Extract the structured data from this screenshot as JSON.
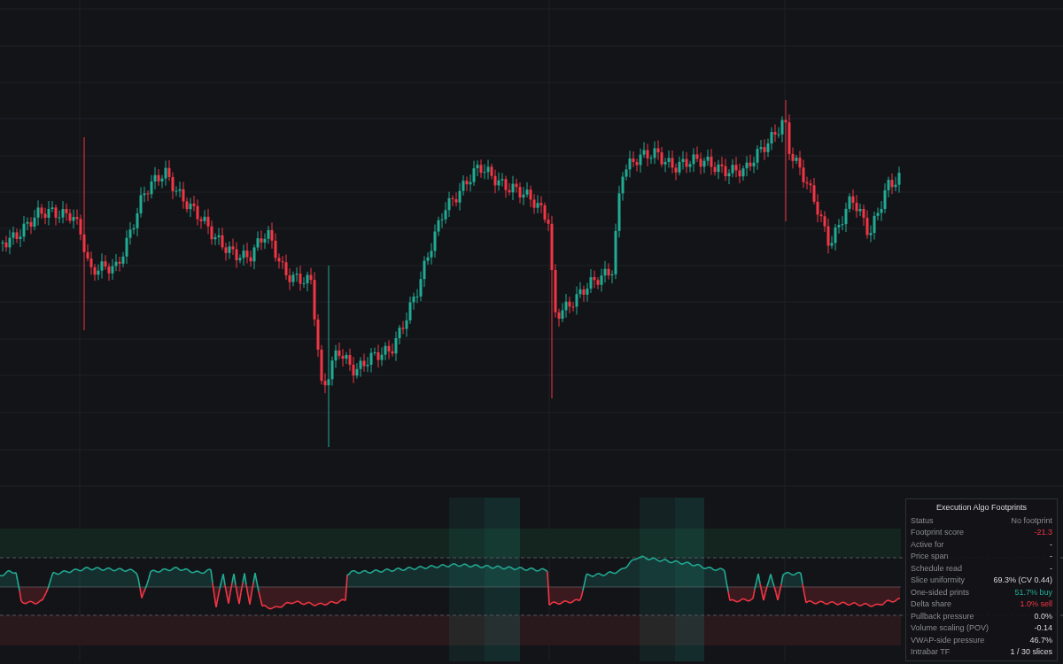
{
  "panel": {
    "title": "Execution Algo Footprints",
    "rows": [
      {
        "label": "Status",
        "value": "No footprint",
        "kind": "muted"
      },
      {
        "label": "Footprint score",
        "value": "-21.3",
        "kind": "sell"
      },
      {
        "label": "Active for",
        "value": "-",
        "kind": "plain"
      },
      {
        "label": "Price span",
        "value": "-",
        "kind": "plain"
      },
      {
        "label": "Schedule read",
        "value": "-",
        "kind": "plain"
      },
      {
        "label": "Slice uniformity",
        "value": "69.3% (CV 0.44)",
        "kind": "plain"
      },
      {
        "label": "One-sided prints",
        "value": "51.7% buy",
        "kind": "buy"
      },
      {
        "label": "Delta share",
        "value": "1.0% sell",
        "kind": "sell"
      },
      {
        "label": "Pullback pressure",
        "value": "0.0%",
        "kind": "plain"
      },
      {
        "label": "Volume scaling (POV)",
        "value": "-0.14",
        "kind": "plain"
      },
      {
        "label": "VWAP-side pressure",
        "value": "46.7%",
        "kind": "plain"
      },
      {
        "label": "Intrabar TF",
        "value": "1 / 30 slices",
        "kind": "plain"
      }
    ]
  }
}
